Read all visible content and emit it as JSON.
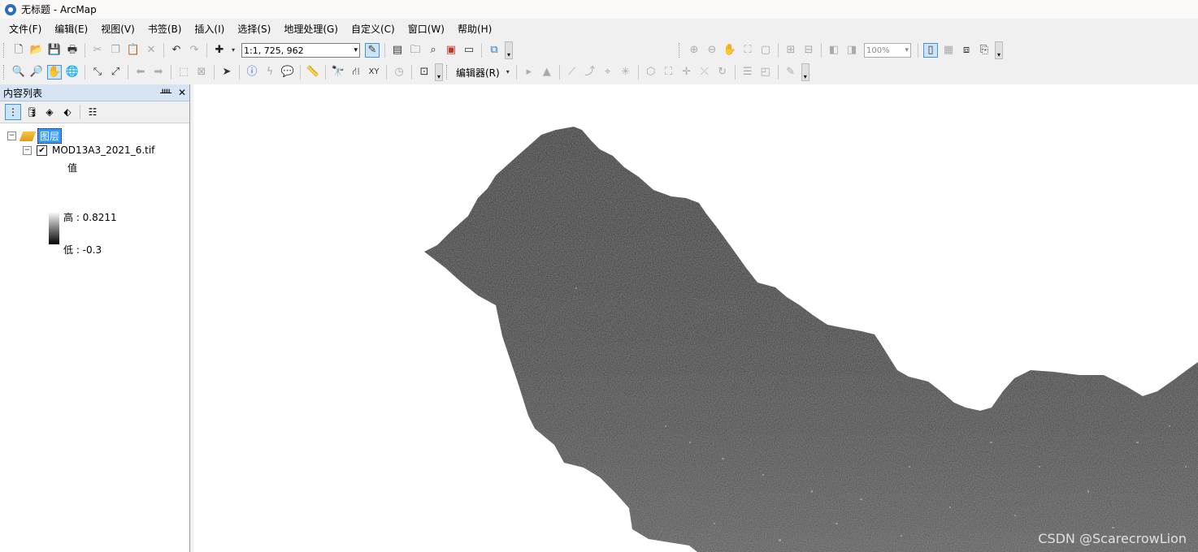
{
  "window": {
    "title": "无标题 - ArcMap"
  },
  "menu": [
    "文件(F)",
    "编辑(E)",
    "视图(V)",
    "书签(B)",
    "插入(I)",
    "选择(S)",
    "地理处理(G)",
    "自定义(C)",
    "窗口(W)",
    "帮助(H)"
  ],
  "toolbar": {
    "scale": "1:1, 725, 962",
    "zoom": "100%",
    "editor": "编辑器(R)"
  },
  "toc": {
    "title": "内容列表",
    "pin": "ᚉ",
    "close": "✕",
    "group_label": "图层",
    "layer_name": "MOD13A3_2021_6.tif",
    "value_label": "值",
    "high": "高 : 0.8211",
    "low": "低 : -0.3",
    "layer_checked": "✔"
  },
  "watermark": "CSDN @ScarecrowLion",
  "colors": {
    "map_background": "#ffffff",
    "raster_dark": "#1a1a1a",
    "selection": "#3399ff"
  }
}
